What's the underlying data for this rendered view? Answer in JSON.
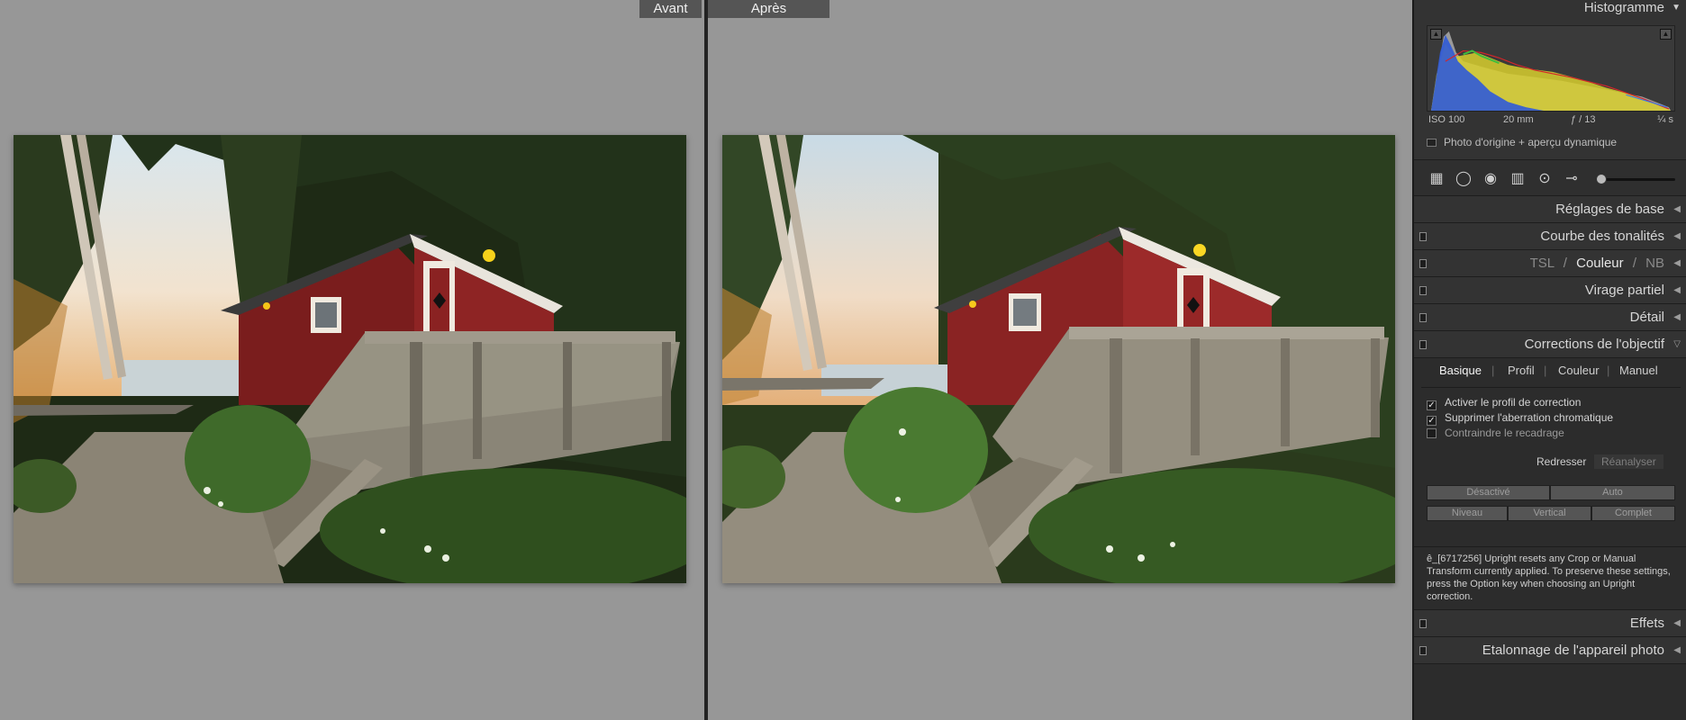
{
  "compare": {
    "before_label": "Avant",
    "after_label": "Après"
  },
  "panel": {
    "histogram": {
      "title": "Histogramme",
      "iso": "ISO 100",
      "focal": "20 mm",
      "aperture": "ƒ / 13",
      "shutter": "¼ s",
      "preview_label": "Photo d'origine + aperçu dynamique"
    },
    "sections": {
      "basic": "Réglages de base",
      "tone_curve": "Courbe des tonalités",
      "hsl": {
        "tsl": "TSL",
        "couleur": "Couleur",
        "nb": "NB",
        "slash": "/"
      },
      "split_toning": "Virage partiel",
      "detail": "Détail",
      "lens": "Corrections de l'objectif",
      "effects": "Effets",
      "calibration": "Etalonnage de l'appareil photo"
    },
    "lens": {
      "tabs": [
        "Basique",
        "Profil",
        "Couleur",
        "Manuel"
      ],
      "checks": {
        "profile": "Activer le profil de correction",
        "ca": "Supprimer l'aberration chromatique",
        "constrain": "Contraindre le recadrage"
      },
      "redresser": "Redresser",
      "reanalyser": "Réanalyser",
      "buttons": {
        "off": "Désactivé",
        "auto": "Auto",
        "level": "Niveau",
        "vertical": "Vertical",
        "full": "Complet"
      },
      "note": "ê_[6717256] Upright resets any Crop or Manual Transform currently applied. To preserve these settings, press the Option key when choosing an Upright correction."
    }
  }
}
